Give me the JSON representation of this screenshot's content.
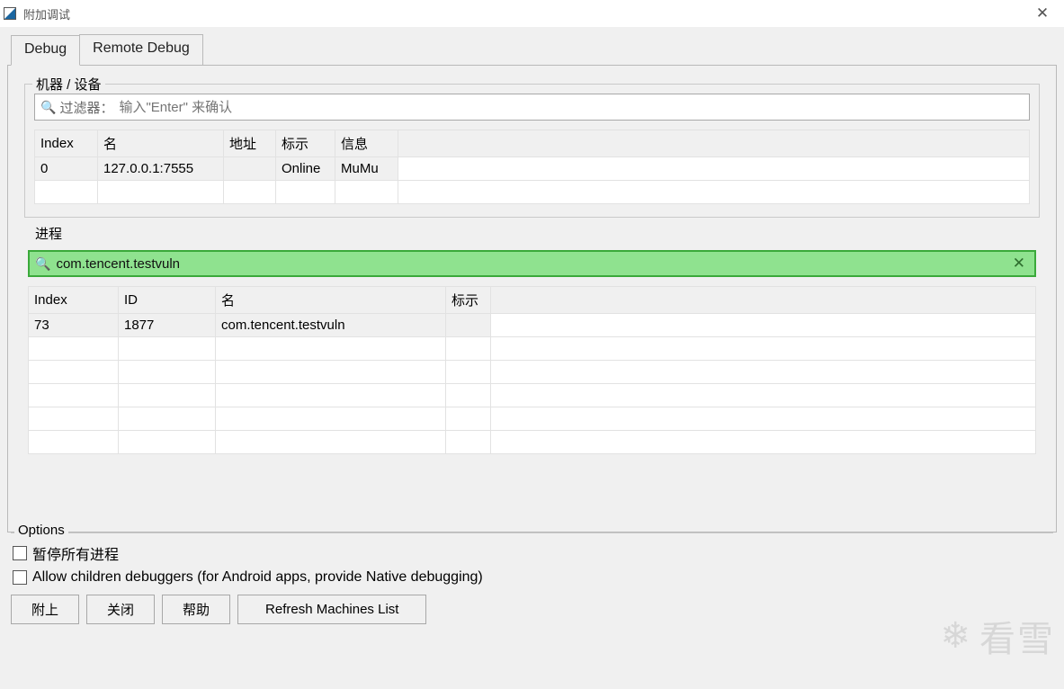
{
  "window": {
    "title": "附加调试"
  },
  "tabs": {
    "debug": "Debug",
    "remote": "Remote Debug",
    "active": "debug"
  },
  "machines": {
    "legend": "机器 / 设备",
    "filter_label": "过滤器：",
    "filter_placeholder": "输入\"Enter\" 来确认",
    "columns": [
      "Index",
      "名",
      "地址",
      "标示",
      "信息"
    ],
    "rows": [
      {
        "index": "0",
        "name": "127.0.0.1:7555",
        "addr": "",
        "flag": "Online",
        "info": "MuMu"
      }
    ]
  },
  "processes": {
    "legend": "进程",
    "filter_value": "com.tencent.testvuln",
    "columns": [
      "Index",
      "ID",
      "名",
      "标示"
    ],
    "rows": [
      {
        "index": "73",
        "id": "1877",
        "name": "com.tencent.testvuln",
        "flag": ""
      }
    ]
  },
  "options": {
    "legend": "Options",
    "suspend_all": "暂停所有进程",
    "allow_children": "Allow children debuggers (for Android apps, provide Native debugging)"
  },
  "buttons": {
    "attach": "附上",
    "close": "关闭",
    "help": "帮助",
    "refresh": "Refresh Machines List"
  },
  "watermark": "看雪"
}
